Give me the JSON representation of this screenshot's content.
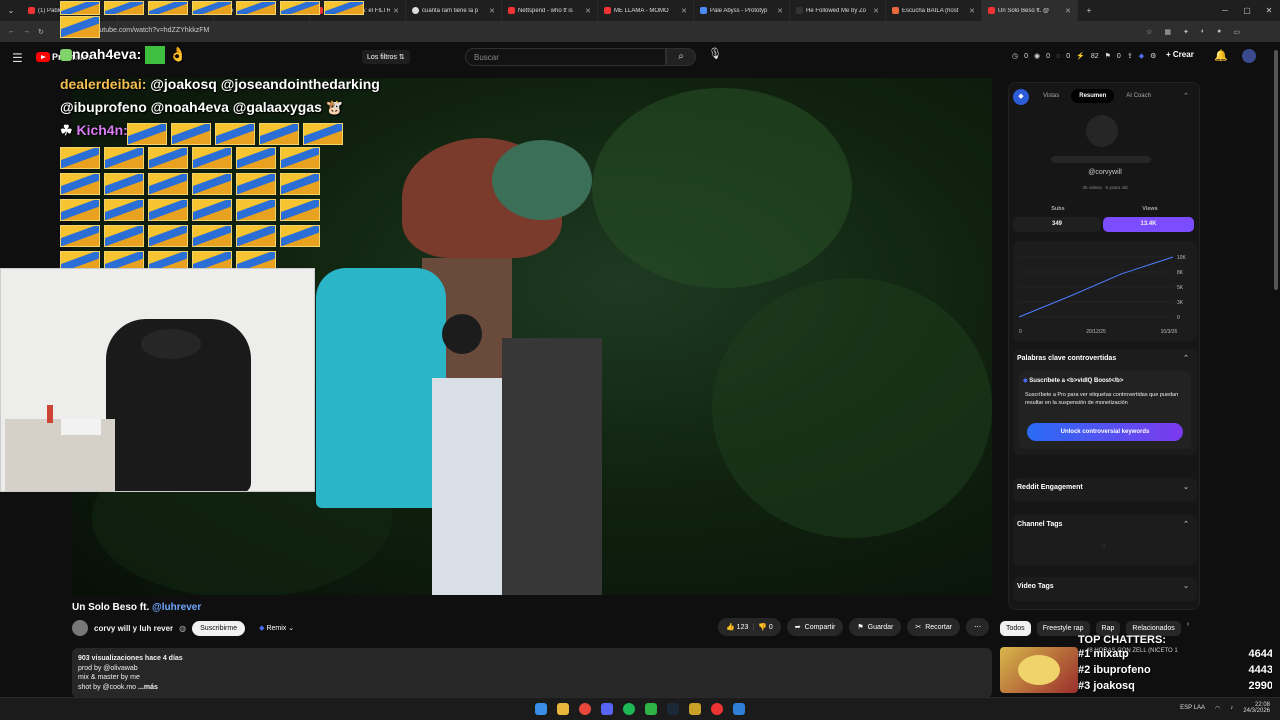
{
  "browser": {
    "tabs": [
      {
        "title": "(1) Pablo"
      },
      {
        "title": ""
      },
      {
        "title": "e"
      },
      {
        "title": "Nvidia DLSS 5: el FILTR"
      },
      {
        "title": "cuanta ram tiene la p"
      },
      {
        "title": "Nettspend - who tf is"
      },
      {
        "title": "ME LLAMA - MOMO"
      },
      {
        "title": "Pale Abyss - Prototyp"
      },
      {
        "title": "He Followed Me by Zo"
      },
      {
        "title": "Escucha BAILA (host"
      },
      {
        "title": "Un Solo Beso ft. @"
      }
    ],
    "url": "youtube.com/watch?v=hdZZYhkkzFM"
  },
  "header": {
    "premium": "Premium",
    "filters": "Los filtros",
    "search_placeholder": "Buscar",
    "stats": [
      "0",
      "0",
      "0",
      "82",
      "0"
    ],
    "create": "Crear"
  },
  "chat": {
    "line1_name": "noah4eva:",
    "line2_name": "dealerdeibai:",
    "line2_text": "@joakosq @joseandointhedarking @ibuprofeno @noah4eva @galaaxygas",
    "line3_name": "Kich4n:"
  },
  "video": {
    "title": "Un Solo Beso ft.",
    "title_mention": "@luhrever",
    "channel": "corvy will y luh rever",
    "subscribe": "Suscribirme",
    "remix": "Remix",
    "likes": "123",
    "dislikes": "0",
    "share": "Compartir",
    "save": "Guardar",
    "clip": "Recortar"
  },
  "description": {
    "stats": "903 visualizaciones  hace 4 días",
    "line1": "prod by @olivawab",
    "line2": "mix & master by me",
    "line3": "shot by @cook.mo",
    "more": "...más"
  },
  "vidiq": {
    "tabs": [
      "Vistas",
      "Resumen",
      "AI Coach"
    ],
    "handle": "@corvywill",
    "meta_videos": "36 videos",
    "meta_age": "6 years old",
    "subs_label": "Subs",
    "subs_value": "349",
    "views_label": "Views",
    "views_value": "13.4K",
    "chart_y_ticks": [
      "10K",
      "8K",
      "5K",
      "3K",
      "0"
    ],
    "chart_x_ticks": [
      "0",
      "20/12/25",
      "10/3/26"
    ],
    "keywords_header": "Palabras clave controvertidas",
    "keywords_promo_title": "Suscríbete a <b>vidIQ Boost</b>",
    "keywords_promo_body": "Suscríbete a Pro para ver etiquetas controvertidas que puedan resultar en la suspensión de monetización",
    "unlock_button": "Unlock controversial keywords",
    "reddit_header": "Reddit Engagement",
    "channel_tags_header": "Channel Tags",
    "video_tags_header": "Video Tags",
    "accent_color": "#7c4dff"
  },
  "related": {
    "chips": [
      "Todos",
      "Freestyle rap",
      "Rap",
      "Relacionados"
    ],
    "title": "48 HORAS CON ZELL (NICETO 1"
  },
  "top_chatters": {
    "title": "TOP CHATTERS:",
    "rows": [
      {
        "rank": "#1",
        "name": "mixatp",
        "count": "4644"
      },
      {
        "rank": "#2",
        "name": "ibuprofeno",
        "count": "4443"
      },
      {
        "rank": "#3",
        "name": "joakosq",
        "count": "2990"
      }
    ]
  },
  "taskbar": {
    "lang": "ESP LAA",
    "date": "24/3/2026",
    "time": "22:08"
  },
  "chart_data": {
    "type": "line",
    "x": [
      "0",
      "20/12/25",
      "10/3/26"
    ],
    "y_ticks": [
      "10K",
      "8K",
      "5K",
      "3K",
      "0"
    ],
    "series": [
      {
        "values": [
          0,
          3500,
          7200,
          10000
        ]
      }
    ]
  }
}
